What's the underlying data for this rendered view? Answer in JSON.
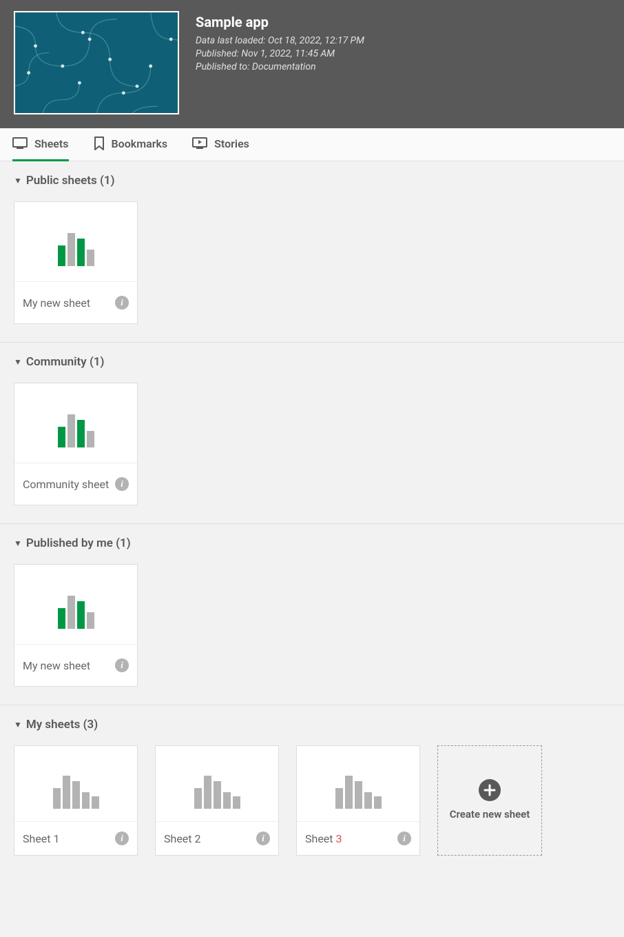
{
  "app": {
    "title": "Sample app",
    "data_loaded": "Data last loaded: Oct 18, 2022, 12:17 PM",
    "published": "Published: Nov 1, 2022, 11:45 AM",
    "published_to": "Published to: Documentation"
  },
  "tabs": {
    "sheets": "Sheets",
    "bookmarks": "Bookmarks",
    "stories": "Stories"
  },
  "sections": {
    "public": {
      "title": "Public sheets (1)",
      "items": [
        {
          "label": "My new sheet"
        }
      ]
    },
    "community": {
      "title": "Community (1)",
      "items": [
        {
          "label": "Community sheet"
        }
      ]
    },
    "published_by_me": {
      "title": "Published by me (1)",
      "items": [
        {
          "label": "My new sheet"
        }
      ]
    },
    "my_sheets": {
      "title": "My sheets (3)",
      "items": [
        {
          "label_prefix": "Sheet ",
          "label_num": "1"
        },
        {
          "label_prefix": "Sheet ",
          "label_num": "2"
        },
        {
          "label_prefix": "Sheet ",
          "label_num": "3"
        }
      ],
      "create_label": "Create new sheet"
    }
  }
}
